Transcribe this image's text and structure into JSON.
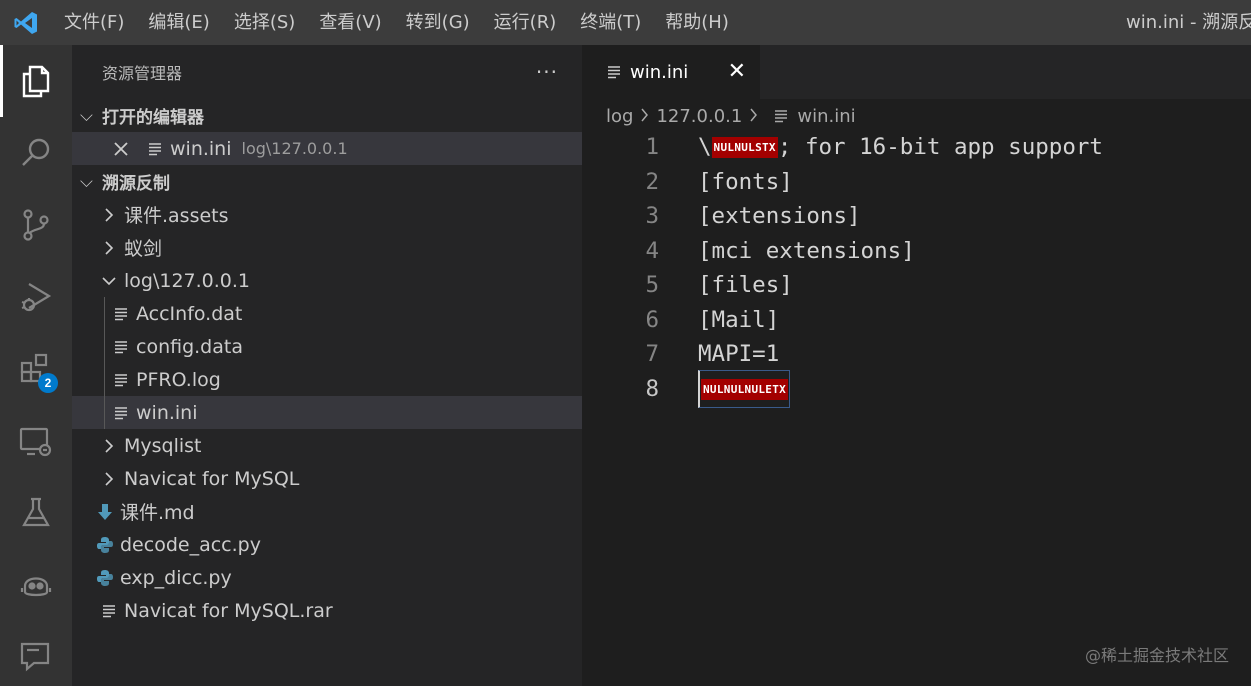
{
  "titlebar": {
    "menu": [
      "文件(F)",
      "编辑(E)",
      "选择(S)",
      "查看(V)",
      "转到(G)",
      "运行(R)",
      "终端(T)",
      "帮助(H)"
    ],
    "window_title": "win.ini - 溯源反制"
  },
  "activitybar": {
    "items": [
      "explorer-icon",
      "search-icon",
      "source-control-icon",
      "run-debug-icon",
      "extensions-icon",
      "remote-explorer-icon",
      "testing-icon",
      "copilot-icon",
      "comments-icon"
    ],
    "extensions_badge": "2"
  },
  "sidebar": {
    "title": "资源管理器",
    "more": "···",
    "open_editors": {
      "label": "打开的编辑器",
      "items": [
        {
          "name": "win.ini",
          "desc": "log\\127.0.0.1"
        }
      ]
    },
    "workspace": {
      "label": "溯源反制",
      "items": [
        {
          "name": "课件.assets"
        },
        {
          "name": "蚁剑"
        },
        {
          "name": "log\\127.0.0.1"
        },
        {
          "name": "AccInfo.dat"
        },
        {
          "name": "config.data"
        },
        {
          "name": "PFRO.log"
        },
        {
          "name": "win.ini"
        },
        {
          "name": "Mysqlist"
        },
        {
          "name": "Navicat for MySQL"
        },
        {
          "name": "课件.md"
        },
        {
          "name": "decode_acc.py"
        },
        {
          "name": "exp_dicc.py"
        },
        {
          "name": "Navicat for MySQL.rar"
        }
      ]
    }
  },
  "editor": {
    "tab": {
      "label": "win.ini",
      "close": "✕"
    },
    "breadcrumb": [
      "log",
      "127.0.0.1",
      "win.ini"
    ],
    "lines": [
      {
        "n": "1",
        "pre": "\\",
        "ctl": "NULNULSTX",
        "post": "; for 16-bit app support"
      },
      {
        "n": "2",
        "text": "[fonts]"
      },
      {
        "n": "3",
        "text": "[extensions]"
      },
      {
        "n": "4",
        "text": "[mci extensions]"
      },
      {
        "n": "5",
        "text": "[files]"
      },
      {
        "n": "6",
        "text": "[Mail]"
      },
      {
        "n": "7",
        "text": "MAPI=1"
      },
      {
        "n": "8",
        "ctl": "NULNULNULETX"
      }
    ]
  },
  "watermark": "@稀土掘金技术社区"
}
